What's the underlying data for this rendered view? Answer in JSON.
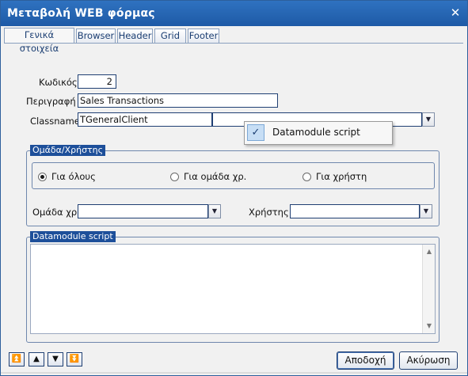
{
  "window": {
    "title": "Μεταβολή  WEB φόρμας",
    "close_glyph": "✕"
  },
  "tabs": [
    {
      "label": "Γενικά στοιχεία",
      "active": true
    },
    {
      "label": "Browser",
      "active": false
    },
    {
      "label": "Header",
      "active": false
    },
    {
      "label": "Grid",
      "active": false
    },
    {
      "label": "Footer",
      "active": false
    }
  ],
  "form": {
    "code_label": "Κωδικός",
    "code_value": "2",
    "description_label": "Περιγραφή",
    "description_value": "Sales Transactions",
    "classname_label": "Classname",
    "classname_value": "TGeneralClient",
    "classname_combo_value": ""
  },
  "dropdown_popup": {
    "items": [
      {
        "label": "Datamodule script",
        "checked": true
      }
    ]
  },
  "group_user": {
    "title": "Ομάδα/Χρήστης",
    "radios": [
      {
        "label": "Για όλους",
        "selected": true
      },
      {
        "label": "Για ομάδα χρ.",
        "selected": false
      },
      {
        "label": "Για χρήστη",
        "selected": false
      }
    ],
    "group_label": "Ομάδα χρ.:",
    "group_value": "",
    "user_label": "Χρήστης:",
    "user_value": ""
  },
  "script_group": {
    "title": "Datamodule script",
    "content": ""
  },
  "nav_buttons": [
    {
      "name": "first",
      "glyph": "⏫"
    },
    {
      "name": "up",
      "glyph": "▲"
    },
    {
      "name": "down",
      "glyph": "▼"
    },
    {
      "name": "last",
      "glyph": "⏬"
    }
  ],
  "buttons": {
    "ok_label": "Αποδοχή",
    "cancel_label": "Ακύρωση"
  },
  "icons": {
    "checkmark": "✓",
    "dropdown_arrow": "▼",
    "scroll_up": "▲",
    "scroll_down": "▼"
  }
}
